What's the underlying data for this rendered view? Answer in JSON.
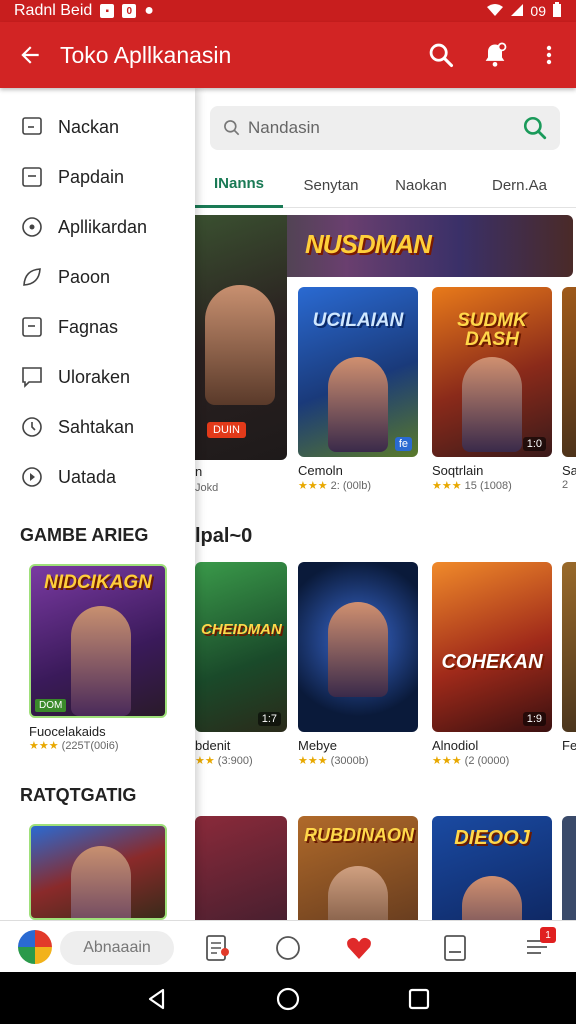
{
  "status_bar": {
    "left_text": "Radnl Beid",
    "right_text": "09"
  },
  "app_bar": {
    "title": "Toko Apllkanasin"
  },
  "search": {
    "placeholder": "Nandasin"
  },
  "tabs": [
    {
      "label": "INanns",
      "active": true
    },
    {
      "label": "Senytan",
      "active": false
    },
    {
      "label": "Naokan",
      "active": false
    },
    {
      "label": "Dern.Aa",
      "active": false
    }
  ],
  "banner": {
    "title": "NUSDMAN"
  },
  "hero": {
    "tag": "DUIN",
    "name": "n",
    "rating": "Jokd"
  },
  "row1": [
    {
      "title": "UCILAIAN",
      "badge": "fe",
      "name": "Cemoln",
      "stars": "★★★",
      "rating_text": "2: (00lb)"
    },
    {
      "title": "SUDMK DASH",
      "badge": "1:0",
      "name": "Soqtrlain",
      "stars": "★★★",
      "rating_text": "15 (1008)"
    },
    {
      "title": "",
      "badge": "",
      "name": "Sa",
      "stars": "",
      "rating_text": "2"
    }
  ],
  "section_title": "lpal~0",
  "row2": [
    {
      "title": "CHEIDMAN",
      "badge": "1:7",
      "name": "bdenit",
      "stars": "★★",
      "rating_text": "(3:900)"
    },
    {
      "title": "",
      "badge": "",
      "name": "Mebye",
      "stars": "★★★",
      "rating_text": "(3000b)"
    },
    {
      "title": "COHEKAN",
      "badge": "1:9",
      "name": "Alnodiol",
      "stars": "★★★",
      "rating_text": "(2 (0000)"
    },
    {
      "title": "",
      "badge": "",
      "name": "Fe",
      "stars": "",
      "rating_text": ""
    }
  ],
  "row3": [
    {
      "title": ""
    },
    {
      "title": "RUBDINAON"
    },
    {
      "title": "DIEOOJ"
    },
    {
      "title": ""
    }
  ],
  "drawer": {
    "items": [
      {
        "label": "Nackan",
        "icon": "chat-square-icon"
      },
      {
        "label": "Papdain",
        "icon": "square-icon"
      },
      {
        "label": "Apllikardan",
        "icon": "circle-dot-icon"
      },
      {
        "label": "Paoon",
        "icon": "leaf-icon"
      },
      {
        "label": "Fagnas",
        "icon": "square-icon"
      },
      {
        "label": "Uloraken",
        "icon": "chat-square-icon"
      },
      {
        "label": "Sahtakan",
        "icon": "clock-icon"
      },
      {
        "label": "Uatada",
        "icon": "play-circle-icon"
      }
    ],
    "heading1": "GAMBE ARIEG",
    "card1": {
      "title": "NIDCIKAGN",
      "tag": "DOM",
      "name": "Fuocelakaids",
      "stars": "★★★",
      "rating_text": "(225T(00i6)"
    },
    "heading2": "RATQTGATIG",
    "card2": {
      "title": ""
    }
  },
  "bottom_bar": {
    "input_label": "Abnaaain",
    "notif_badge": "1"
  },
  "colors": {
    "primary": "#d22424",
    "accent": "#1a7a55",
    "star": "#e8a800"
  }
}
